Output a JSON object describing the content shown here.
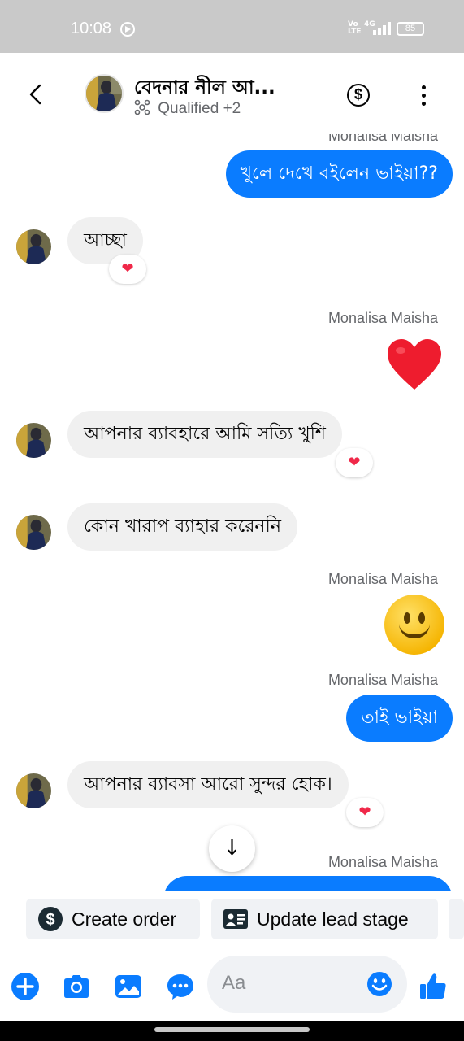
{
  "status_bar": {
    "time": "10:08",
    "network": "Vo LTE",
    "network_type": "4G",
    "battery": "85"
  },
  "header": {
    "title": "বেদনার নীল আ...",
    "lead_stage": "Qualified",
    "extra_labels": "+2",
    "icons": {
      "back": "chevron-left-icon",
      "payment": "dollar-circle-icon",
      "more": "more-vertical-icon"
    }
  },
  "messages": [
    {
      "direction": "outgoing",
      "sender": "Monalisa Maisha",
      "text": "খুলে দেখে বইলেন ভাইয়া??"
    },
    {
      "direction": "incoming",
      "text": "আচ্ছা",
      "reaction": "❤"
    },
    {
      "direction": "outgoing",
      "sender": "Monalisa Maisha",
      "emoji": "heart"
    },
    {
      "direction": "incoming",
      "text": "আপনার ব্যাবহারে আমি সত্যি খুশি",
      "reaction": "❤"
    },
    {
      "direction": "incoming",
      "text": "কোন খারাপ ব্যাহার করেননি"
    },
    {
      "direction": "outgoing",
      "sender": "Monalisa Maisha",
      "emoji": "smiling-face"
    },
    {
      "direction": "outgoing",
      "sender": "Monalisa Maisha",
      "text": "তাই ভাইয়া"
    },
    {
      "direction": "incoming",
      "text": "আপনার ব্যাবসা আরো সুন্দর হোক।",
      "reaction": "❤"
    },
    {
      "direction": "outgoing",
      "sender": "Monalisa Maisha",
      "text": ""
    }
  ],
  "scroll_down_icon": "arrow-down-icon",
  "quick_actions": {
    "create_order": "Create order",
    "update_lead_stage": "Update lead stage"
  },
  "composer": {
    "placeholder": "Aa",
    "icons": [
      "plus-icon",
      "camera-icon",
      "gallery-icon",
      "chat-bubble-icon",
      "emoji-icon",
      "like-icon"
    ]
  },
  "colors": {
    "accent": "#0a7cff",
    "incoming_bubble": "#f0f0f0",
    "reaction_heart": "#f02849",
    "status_bar": "#c9c9c9"
  }
}
